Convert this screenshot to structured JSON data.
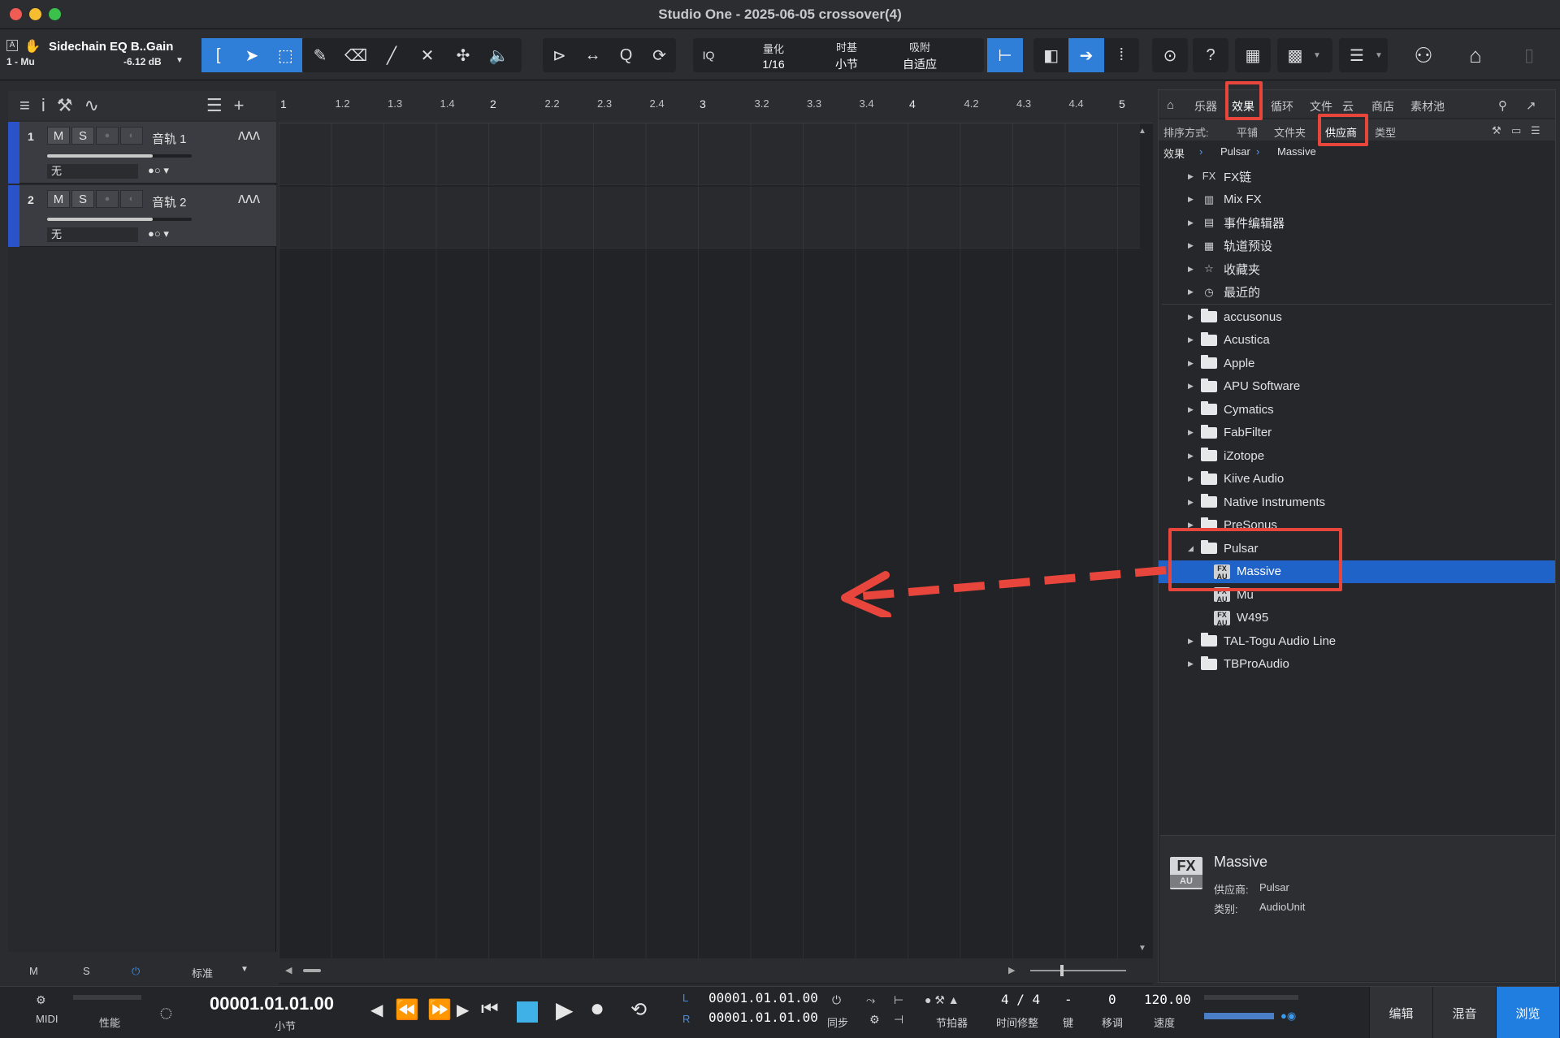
{
  "window": {
    "title": "Studio One - 2025-06-05 crossover(4)"
  },
  "track_info": {
    "name": "Sidechain EQ B..Gain",
    "sub": "1 - Mu",
    "gain": "-6.12 dB"
  },
  "toolbar": {
    "iq": "IQ",
    "quantize": {
      "label": "量化",
      "value": "1/16"
    },
    "timebase": {
      "label": "时基",
      "value": "小节"
    },
    "snap": {
      "label": "吸附",
      "value": "自适应"
    },
    "help": "?"
  },
  "tracks": [
    {
      "num": "1",
      "name": "音轨 1",
      "m": "M",
      "s": "S",
      "io": "无"
    },
    {
      "num": "2",
      "name": "音轨 2",
      "m": "M",
      "s": "S",
      "io": "无"
    }
  ],
  "ruler": {
    "labels": [
      "1",
      "1.2",
      "1.3",
      "1.4",
      "2",
      "2.2",
      "2.3",
      "2.4",
      "3",
      "3.2",
      "3.3",
      "3.4",
      "4",
      "4.2",
      "4.3",
      "4.4",
      "5"
    ]
  },
  "left_bottom": {
    "m": "M",
    "s": "S",
    "mode": "标准"
  },
  "browser": {
    "tabs": [
      "乐器",
      "效果",
      "循环",
      "文件",
      "云",
      "商店",
      "素材池"
    ],
    "sort": {
      "label": "排序方式:",
      "options": [
        "平铺",
        "文件夹",
        "供应商",
        "类型"
      ]
    },
    "breadcrumb": [
      "效果",
      "Pulsar",
      "Massive"
    ],
    "top_items": [
      "FX链",
      "Mix FX",
      "事件编辑器",
      "轨道预设",
      "收藏夹",
      "最近的"
    ],
    "vendors_before": [
      "accusonus",
      "Acustica",
      "Apple",
      "APU Software",
      "Cymatics",
      "FabFilter",
      "iZotope",
      "Kiive Audio",
      "Native Instruments",
      "PreSonus"
    ],
    "pulsar": {
      "name": "Pulsar",
      "children": [
        "Massive",
        "Mu",
        "W495"
      ]
    },
    "vendors_after": [
      "TAL-Togu Audio Line",
      "TBProAudio"
    ],
    "info": {
      "fx": "FX",
      "au": "AU",
      "name": "Massive",
      "vendor_label": "供应商:",
      "vendor": "Pulsar",
      "category_label": "类别:",
      "category": "AudioUnit"
    }
  },
  "transport": {
    "midi": "MIDI",
    "perf": "性能",
    "position": "00001.01.01.00",
    "position_unit": "小节",
    "l_label": "L",
    "r_label": "R",
    "l_time": "00001.01.01.00",
    "r_time": "00001.01.01.00",
    "sync": "同步",
    "metronome": "节拍器",
    "signature": "4 / 4",
    "signature_label": "时间修整",
    "key": "-",
    "key_label": "键",
    "transpose": "0",
    "transpose_label": "移调",
    "tempo": "120.00",
    "tempo_label": "速度"
  },
  "modes": [
    "编辑",
    "混音",
    "浏览"
  ],
  "colors": {
    "accent": "#1f7ee0",
    "highlight": "#e8463c",
    "track": "#2a53c9"
  }
}
